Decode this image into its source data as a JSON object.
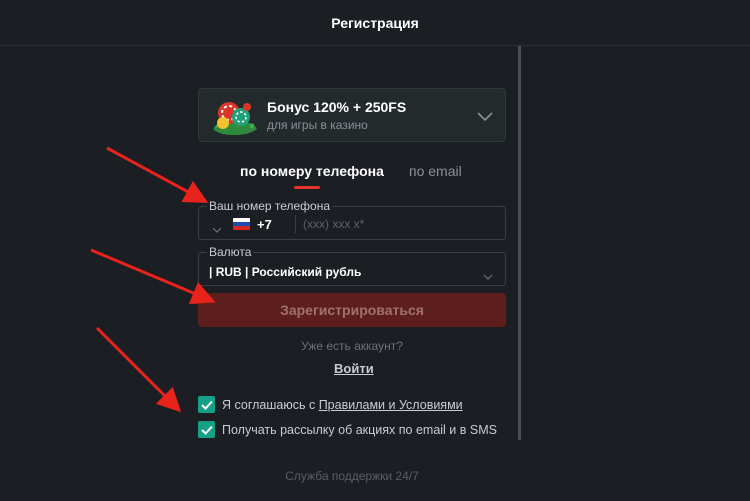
{
  "header": {
    "title": "Регистрация"
  },
  "bonus": {
    "title": "Бонус 120% + 250FS",
    "subtitle": "для игры в казино"
  },
  "tabs": [
    {
      "label": "по номеру телефона",
      "active": true
    },
    {
      "label": "по email",
      "active": false
    }
  ],
  "phone": {
    "label": "Ваш номер телефона",
    "country_code": "+7",
    "placeholder": "(xxx) xxx x*",
    "value": ""
  },
  "currency": {
    "label": "Валюта",
    "value": "| RUB | Российский рубль"
  },
  "register_button": {
    "label": "Зарегистрироваться"
  },
  "login": {
    "prompt": "Уже есть аккаунт?",
    "link": "Войти"
  },
  "consents": [
    {
      "prefix": "Я соглашаюсь с ",
      "link": "Правилами и Условиями",
      "checked": true
    },
    {
      "text": "Получать рассылку об акциях по email и в SMS",
      "checked": true
    }
  ],
  "footer": {
    "support": "Служба поддержки 24/7"
  },
  "colors": {
    "background": "#1b1e23",
    "accent_red": "#e3342a",
    "button_disabled": "#5e1e1c",
    "checkbox_green": "#16a085",
    "annotation_arrow": "#e8231c"
  },
  "icons": [
    "chevron-down-icon",
    "russia-flag-icon",
    "checkmark-icon",
    "casino-chips-icon",
    "red-arrow-annotation"
  ]
}
